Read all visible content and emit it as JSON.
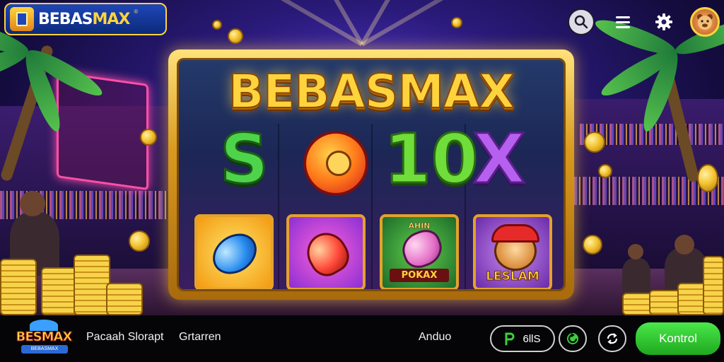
{
  "brand": {
    "name_a": "BEBAS",
    "name_b": "MAX",
    "mark": "®"
  },
  "header": {
    "search_icon": "search-icon",
    "menu_icon": "hamburger-menu-icon",
    "settings_icon": "gear-icon",
    "avatar_icon": "bear-avatar-icon"
  },
  "game": {
    "title": "BEBASMAX",
    "reel_symbols": [
      "S",
      "O",
      "10",
      "X"
    ],
    "tiles": [
      {
        "icon": "blue-gem-icon",
        "label": ""
      },
      {
        "icon": "red-rocket-icon",
        "label": ""
      },
      {
        "icon": "pink-fish-icon",
        "top_label": "AHIN",
        "label": "POKAX"
      },
      {
        "icon": "bear-mascot-icon",
        "label": "LESLAM"
      }
    ]
  },
  "bottom_bar": {
    "logo_text": "BESMAX",
    "logo_sub": "BEBASMAX",
    "text_1": "Pacaah Slorapt",
    "text_2": "Grtarren",
    "text_3": "Anduo",
    "pill_1_label": "6llS",
    "pill_1_icon": "p-icon",
    "pill_2_icon": "refresh-icon",
    "pill_3_icon": "sync-icon",
    "cta_label": "Kontrol"
  },
  "colors": {
    "accent_gold": "#ffd33d",
    "cta_green": "#2fc92f",
    "brand_blue": "#1e46b8"
  }
}
